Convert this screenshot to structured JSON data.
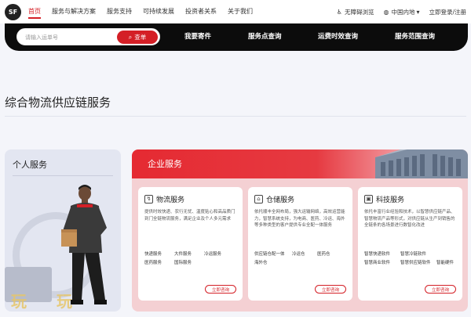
{
  "brand": {
    "logo_text": "SF",
    "accent": "#d41f26"
  },
  "nav": {
    "items": [
      "首页",
      "服务与解决方案",
      "服务支持",
      "可持续发展",
      "投资者关系",
      "关于我们"
    ],
    "active_index": 0
  },
  "util": {
    "accessibility": "无障碍浏览",
    "region": "中国内地",
    "login": "立即登录/注册"
  },
  "search": {
    "placeholder": "请输入运单号",
    "button": "查单",
    "quick_links": [
      "我要寄件",
      "服务点查询",
      "运费时效查询",
      "服务范围查询"
    ]
  },
  "main_title": "综合物流供应链服务",
  "personal": {
    "title": "个人服务",
    "watermark_text": "玩玩"
  },
  "enterprise": {
    "title": "企业服务",
    "cards": [
      {
        "title": "物流服务",
        "desc": "提供时效快递、农行无忧、温度贴心和高品质门到门全链物流服务，满足企业及个人多元需求",
        "tags": [
          "快递服务",
          "大件服务",
          "冷运服务",
          "医药服务",
          "国际服务"
        ],
        "consult": "立即咨询"
      },
      {
        "title": "仓储服务",
        "desc": "依托顺丰全网布局，强大运输网络，高效运营能力，智慧系统支持，为电商、医药、冷运、海外等多种类型的客户提供专业全配一体服务",
        "tags": [
          "供应链仓配一体",
          "冷运仓",
          "医药仓",
          "海外仓"
        ],
        "consult": "立即咨询"
      },
      {
        "title": "科技服务",
        "desc": "依托丰富行业经验和技术，以智慧供应链产品、智慧物流产品等形式，对供应链从生产到销售的全链条的各场景进行数智化改进",
        "tags": [
          "智慧快递软件",
          "智慧冷链软件",
          "智慧商业软件",
          "智慧供应链软件",
          "智能硬件"
        ],
        "consult": "立即咨询"
      }
    ]
  }
}
